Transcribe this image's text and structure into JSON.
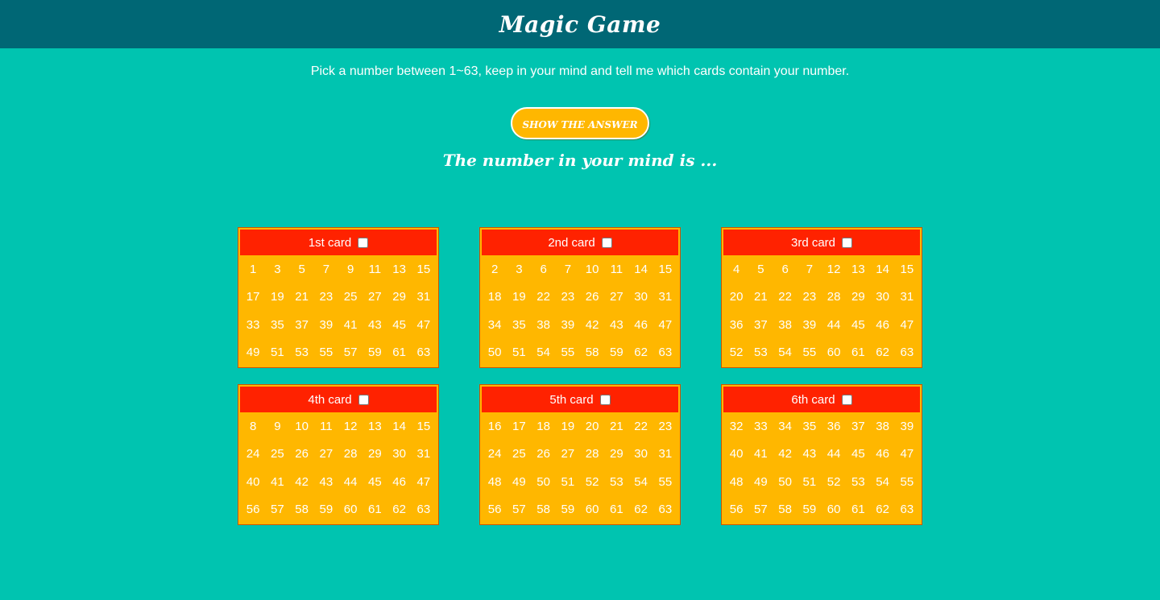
{
  "header": {
    "title": "Magic Game"
  },
  "instructions": "Pick a number between 1~63, keep in your mind and tell me which cards contain your number.",
  "answer_button": "SHOW THE ANSWER",
  "result_text": "The number in your mind is ...",
  "colors": {
    "background": "#00c4b0",
    "header": "#006775",
    "card_body": "#ffb700",
    "card_header": "#ff2200",
    "text": "#ffffff"
  },
  "cards": [
    {
      "label": "1st card",
      "checked": false,
      "numbers": [
        "1",
        "3",
        "5",
        "7",
        "9",
        "11",
        "13",
        "15",
        "17",
        "19",
        "21",
        "23",
        "25",
        "27",
        "29",
        "31",
        "33",
        "35",
        "37",
        "39",
        "41",
        "43",
        "45",
        "47",
        "49",
        "51",
        "53",
        "55",
        "57",
        "59",
        "61",
        "63"
      ]
    },
    {
      "label": "2nd card",
      "checked": false,
      "numbers": [
        "2",
        "3",
        "6",
        "7",
        "10",
        "11",
        "14",
        "15",
        "18",
        "19",
        "22",
        "23",
        "26",
        "27",
        "30",
        "31",
        "34",
        "35",
        "38",
        "39",
        "42",
        "43",
        "46",
        "47",
        "50",
        "51",
        "54",
        "55",
        "58",
        "59",
        "62",
        "63"
      ]
    },
    {
      "label": "3rd card",
      "checked": false,
      "numbers": [
        "4",
        "5",
        "6",
        "7",
        "12",
        "13",
        "14",
        "15",
        "20",
        "21",
        "22",
        "23",
        "28",
        "29",
        "30",
        "31",
        "36",
        "37",
        "38",
        "39",
        "44",
        "45",
        "46",
        "47",
        "52",
        "53",
        "54",
        "55",
        "60",
        "61",
        "62",
        "63"
      ]
    },
    {
      "label": "4th card",
      "checked": false,
      "numbers": [
        "8",
        "9",
        "10",
        "11",
        "12",
        "13",
        "14",
        "15",
        "24",
        "25",
        "26",
        "27",
        "28",
        "29",
        "30",
        "31",
        "40",
        "41",
        "42",
        "43",
        "44",
        "45",
        "46",
        "47",
        "56",
        "57",
        "58",
        "59",
        "60",
        "61",
        "62",
        "63"
      ]
    },
    {
      "label": "5th card",
      "checked": false,
      "numbers": [
        "16",
        "17",
        "18",
        "19",
        "20",
        "21",
        "22",
        "23",
        "24",
        "25",
        "26",
        "27",
        "28",
        "29",
        "30",
        "31",
        "48",
        "49",
        "50",
        "51",
        "52",
        "53",
        "54",
        "55",
        "56",
        "57",
        "58",
        "59",
        "60",
        "61",
        "62",
        "63"
      ]
    },
    {
      "label": "6th card",
      "checked": false,
      "numbers": [
        "32",
        "33",
        "34",
        "35",
        "36",
        "37",
        "38",
        "39",
        "40",
        "41",
        "42",
        "43",
        "44",
        "45",
        "46",
        "47",
        "48",
        "49",
        "50",
        "51",
        "52",
        "53",
        "54",
        "55",
        "56",
        "57",
        "58",
        "59",
        "60",
        "61",
        "62",
        "63"
      ]
    }
  ]
}
